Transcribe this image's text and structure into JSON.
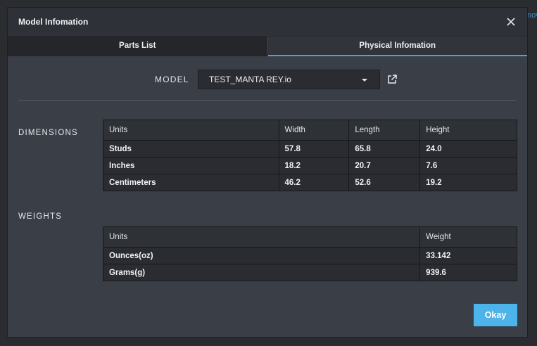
{
  "dialog": {
    "title": "Model Infomation",
    "close_icon": "close-icon"
  },
  "tabs": [
    {
      "label": "Parts List",
      "active": false
    },
    {
      "label": "Physical Infomation",
      "active": true
    }
  ],
  "model": {
    "label": "MODEL",
    "selected": "TEST_MANTA REY.io",
    "external_icon": "external-link-icon"
  },
  "dimensions": {
    "label": "DIMENSIONS",
    "headers": [
      "Units",
      "Width",
      "Length",
      "Height"
    ],
    "rows": [
      [
        "Studs",
        "57.8",
        "65.8",
        "24.0"
      ],
      [
        "Inches",
        "18.2",
        "20.7",
        "7.6"
      ],
      [
        "Centimeters",
        "46.2",
        "52.6",
        "19.2"
      ]
    ]
  },
  "weights": {
    "label": "WEIGHTS",
    "headers": [
      "Units",
      "Weight"
    ],
    "rows": [
      [
        "Ounces(oz)",
        "33.142"
      ],
      [
        "Grams(g)",
        "939.6"
      ]
    ]
  },
  "actions": {
    "okay_label": "Okay"
  },
  "colors": {
    "accent": "#4cb4ea",
    "dialog_bg": "#3a3e46",
    "table_bg": "#2a2c31"
  }
}
